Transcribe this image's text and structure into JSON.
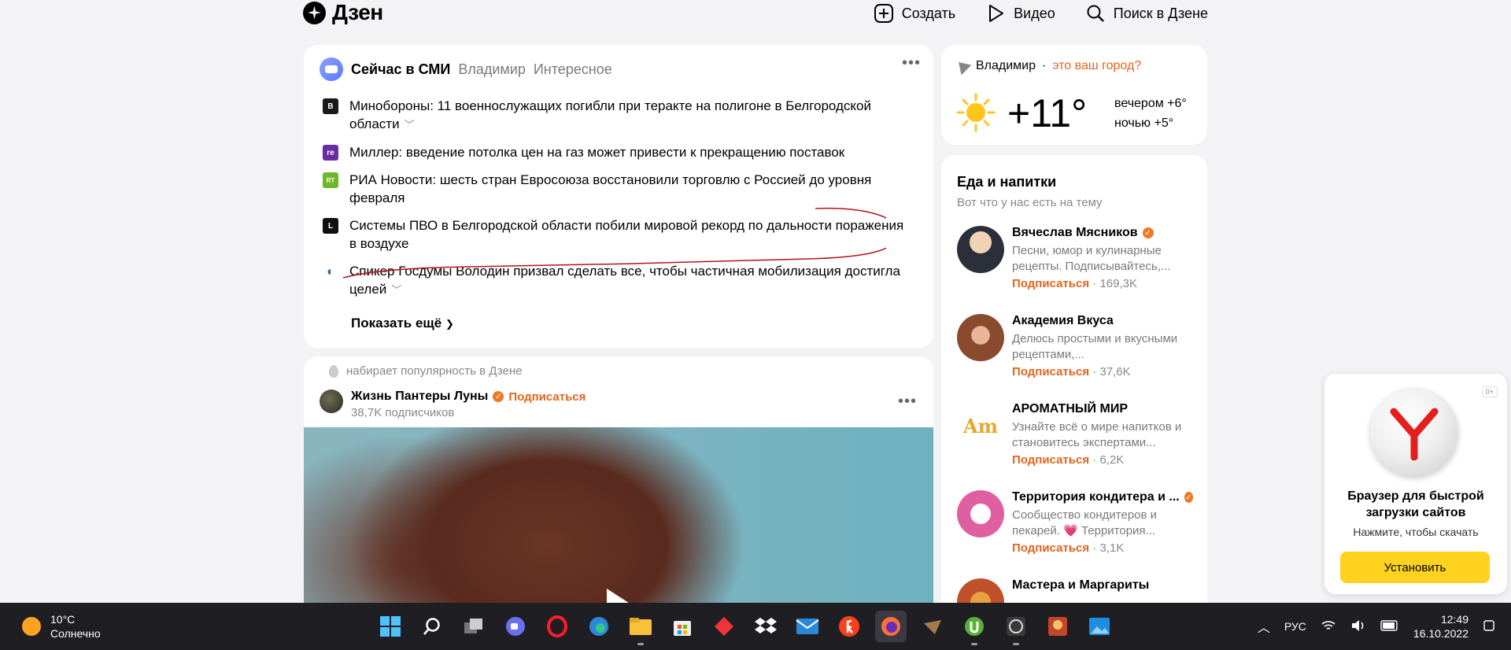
{
  "header": {
    "logo": "Дзен",
    "create": "Создать",
    "video": "Видео",
    "search": "Поиск в Дзене"
  },
  "news": {
    "title": "Сейчас в СМИ",
    "tabs": [
      "Владимир",
      "Интересное"
    ],
    "items": [
      {
        "source": "B",
        "color": "#1a1a1a",
        "text": "Минобороны: 11 военнослужащих погибли при теракте на полигоне в Белгородской области",
        "expand": true
      },
      {
        "source": "re",
        "color": "#6a2ca0",
        "text": "Миллер: введение потолка цен на газ может привести к прекращению поставок",
        "expand": false
      },
      {
        "source": "RT",
        "color": "#6bb82a",
        "text": "РИА Новости: шесть стран Евросоюза восстановили торговлю с Россией до уровня февраля",
        "expand": false
      },
      {
        "source": "L",
        "color": "#111111",
        "text": "Системы ПВО в Белгородской области побили мировой рекорд по дальности поражения в воздухе",
        "expand": false
      },
      {
        "source": "◐",
        "color": "#2a5fb0",
        "text": "Спикер Госдумы Володин призвал сделать все, чтобы частичная мобилизация достигла целей",
        "expand": true
      }
    ],
    "show_more": "Показать ещё"
  },
  "post": {
    "trend": "набирает популярность в Дзене",
    "author": "Жизнь Пантеры Луны",
    "subscribe": "Подписаться",
    "subscribers": "38,7K подписчиков"
  },
  "weather": {
    "city": "Владимир",
    "question": "это ваш город?",
    "temp": "+11°",
    "evening": "вечером +6°",
    "night": "ночью +5°"
  },
  "food": {
    "title": "Еда и напитки",
    "subtitle": "Вот что у нас есть на тему",
    "channels": [
      {
        "name": "Вячеслав Мясников",
        "verified": true,
        "desc": "Песни, юмор и кулинарные рецепты. Подписывайтесь,...",
        "subscribe": "Подписаться",
        "count": "169,3K",
        "ava": "#2a2f3a"
      },
      {
        "name": "Академия Вкуса",
        "verified": false,
        "desc": "Делюсь простыми и вкусными рецептами,...",
        "subscribe": "Подписаться",
        "count": "37,6K",
        "ava": "#8a4a2e"
      },
      {
        "name": "АРОМАТНЫЙ МИР",
        "verified": false,
        "desc": "Узнайте всё о мире напитков и становитесь экспертами...",
        "subscribe": "Подписаться",
        "count": "6,2K",
        "ava": "#e8c23a"
      },
      {
        "name": "Территория кондитера и ...",
        "verified": true,
        "desc": "Сообщество кондитеров и пекарей. 💗 Территория...",
        "subscribe": "Подписаться",
        "count": "3,1K",
        "ava": "#e05fa0"
      },
      {
        "name": "Мастера и Маргариты",
        "verified": false,
        "desc": "",
        "subscribe": "",
        "count": "",
        "ava": "#c0502a"
      }
    ],
    "separator": "·"
  },
  "promo": {
    "age": "0+",
    "title": "Браузер для быстрой загрузки сайтов",
    "subtitle": "Нажмите, чтобы скачать",
    "button": "Установить"
  },
  "taskbar": {
    "temp": "10°C",
    "condition": "Солнечно",
    "lang": "РУС",
    "time": "12:49",
    "date": "16.10.2022"
  }
}
